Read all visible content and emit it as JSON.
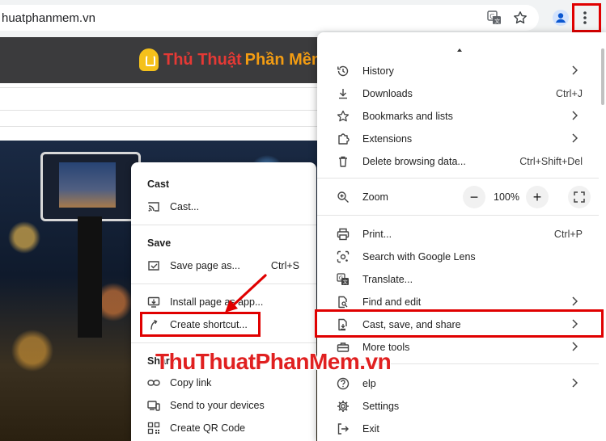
{
  "browser": {
    "url": "huatphanmem.vn"
  },
  "site": {
    "logo_part1": "Thủ Thuật",
    "logo_part2": "Phần Mềm",
    "watermark": "ThuThuatPhanMem.vn"
  },
  "chrome_menu": {
    "items": [
      {
        "label": "History",
        "shortcut": "",
        "submenu": true,
        "icon": "history-icon"
      },
      {
        "label": "Downloads",
        "shortcut": "Ctrl+J",
        "submenu": false,
        "icon": "download-icon"
      },
      {
        "label": "Bookmarks and lists",
        "shortcut": "",
        "submenu": true,
        "icon": "star-icon"
      },
      {
        "label": "Extensions",
        "shortcut": "",
        "submenu": true,
        "icon": "puzzle-icon"
      },
      {
        "label": "Delete browsing data...",
        "shortcut": "Ctrl+Shift+Del",
        "submenu": false,
        "icon": "trash-icon"
      },
      {
        "label": "Print...",
        "shortcut": "Ctrl+P",
        "submenu": false,
        "icon": "print-icon"
      },
      {
        "label": "Search with Google Lens",
        "shortcut": "",
        "submenu": false,
        "icon": "lens-icon"
      },
      {
        "label": "Translate...",
        "shortcut": "",
        "submenu": false,
        "icon": "translate-icon"
      },
      {
        "label": "Find and edit",
        "shortcut": "",
        "submenu": true,
        "icon": "find-icon"
      },
      {
        "label": "Cast, save, and share",
        "shortcut": "",
        "submenu": true,
        "icon": "cast-save-icon"
      },
      {
        "label": "More tools",
        "shortcut": "",
        "submenu": true,
        "icon": "toolbox-icon"
      },
      {
        "label": "elp",
        "shortcut": "",
        "submenu": true,
        "icon": "help-icon"
      },
      {
        "label": "Settings",
        "shortcut": "",
        "submenu": false,
        "icon": "gear-icon"
      },
      {
        "label": "Exit",
        "shortcut": "",
        "submenu": false,
        "icon": "exit-icon"
      }
    ],
    "zoom": {
      "label": "Zoom",
      "value": "100%",
      "minus": "−",
      "plus": "+"
    }
  },
  "submenu": {
    "cast_heading": "Cast",
    "cast_item": "Cast...",
    "save_heading": "Save",
    "save_page": "Save page as...",
    "save_shortcut": "Ctrl+S",
    "install_page": "Install page as app...",
    "create_shortcut": "Create shortcut...",
    "share_heading": "Share",
    "copy_link": "Copy link",
    "send_devices": "Send to your devices",
    "qr_code": "Create QR Code"
  },
  "colors": {
    "highlight": "#e00000",
    "site_header": "#3b3b3d",
    "logo_red": "#e53935",
    "logo_orange": "#f39c12"
  }
}
